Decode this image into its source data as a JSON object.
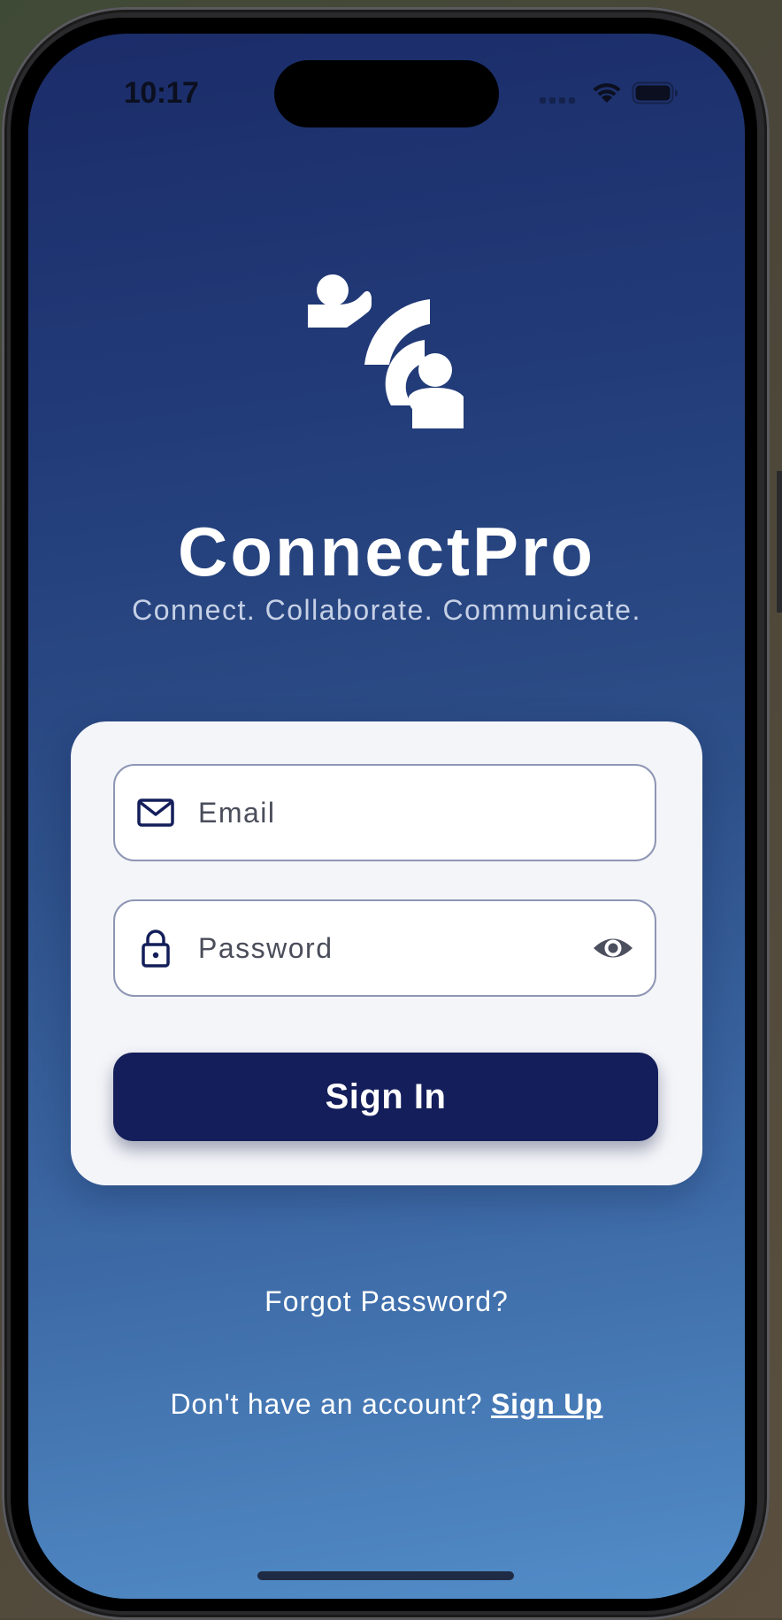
{
  "status_bar": {
    "time": "10:17",
    "signal_icon": "cellular-signal-icon",
    "wifi_icon": "wifi-icon",
    "battery_icon": "battery-icon"
  },
  "branding": {
    "logo_icon": "people-connect-icon",
    "app_name": "ConnectPro",
    "tagline": "Connect. Collaborate. Communicate."
  },
  "form": {
    "email": {
      "placeholder": "Email",
      "value": "",
      "icon": "envelope-icon"
    },
    "password": {
      "placeholder": "Password",
      "value": "",
      "icon": "lock-icon",
      "toggle_icon": "eye-icon"
    },
    "submit_label": "Sign In"
  },
  "links": {
    "forgot_password": "Forgot Password?",
    "signup_prompt": "Don't have an account?",
    "signup_label": "Sign Up"
  },
  "colors": {
    "gradient_top": "#1b2c69",
    "gradient_bottom": "#528dc8",
    "card_background": "#f4f5f9",
    "button_background": "#131e5a",
    "icon_color": "#131e5a"
  }
}
